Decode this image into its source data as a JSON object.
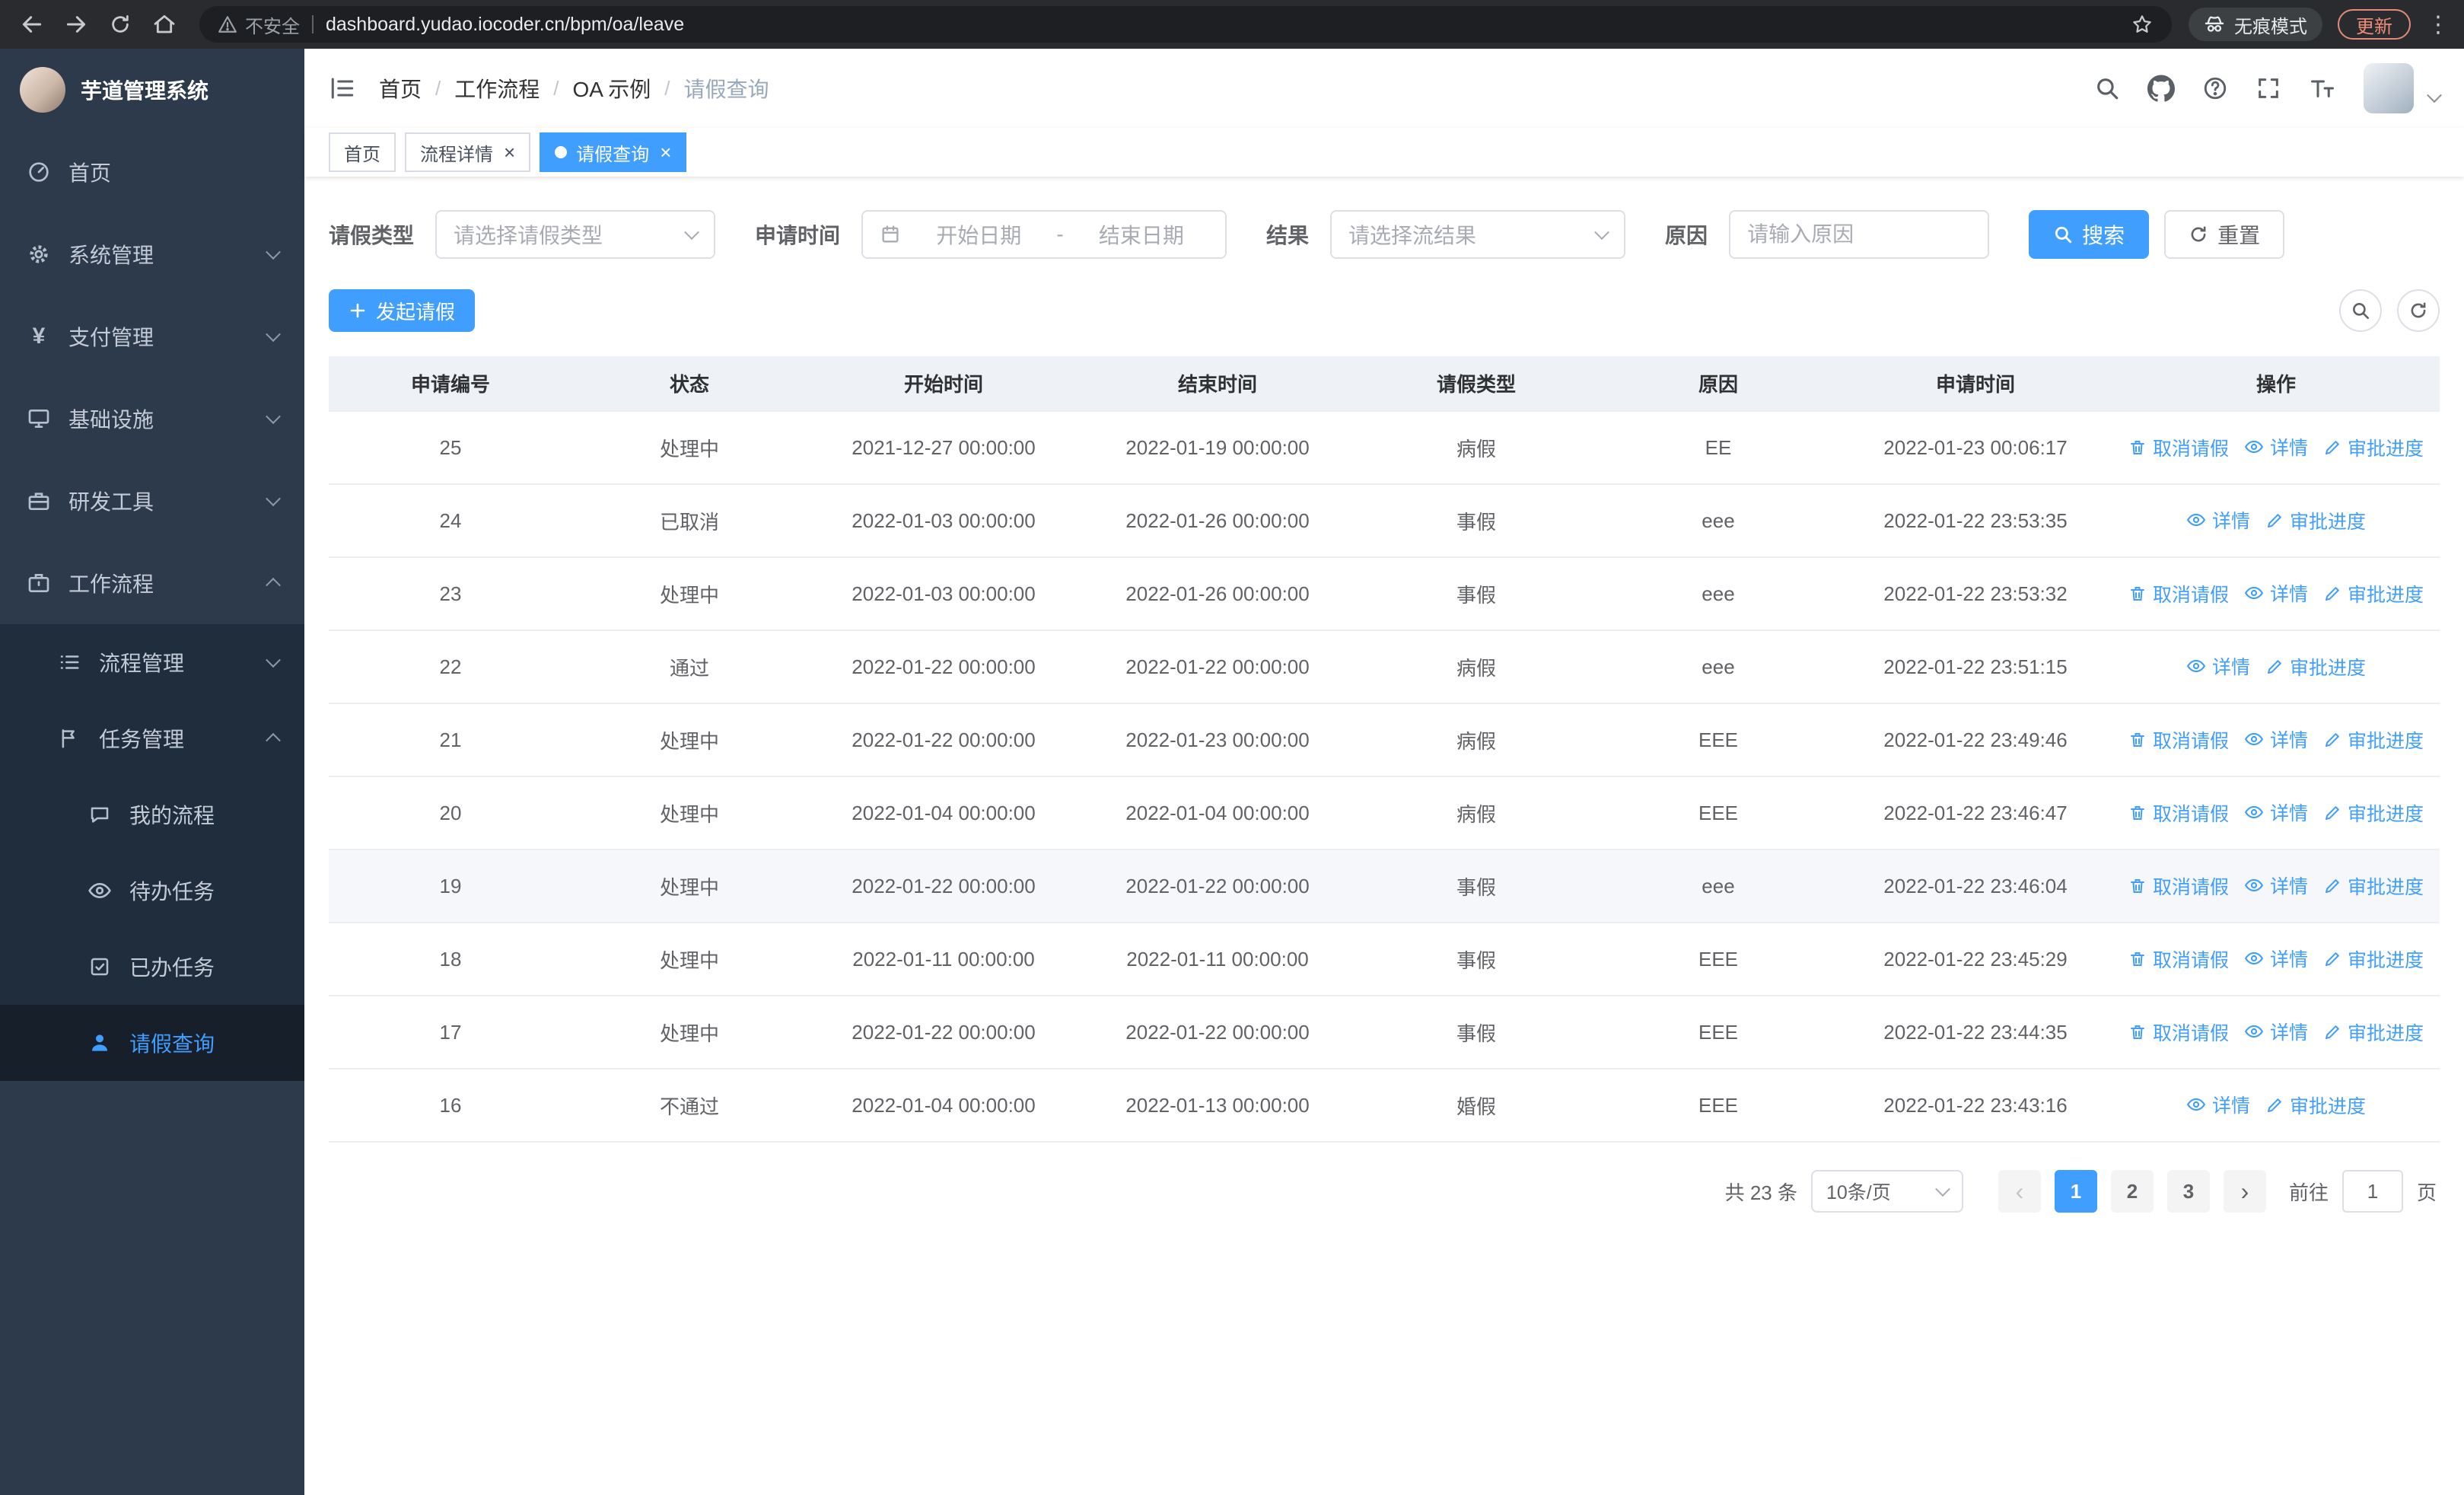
{
  "browser": {
    "security_label": "不安全",
    "url": "dashboard.yudao.iocoder.cn/bpm/oa/leave",
    "incognito_label": "无痕模式",
    "update_label": "更新"
  },
  "sidebar": {
    "logo_title": "芋道管理系统",
    "items": [
      {
        "label": "首页",
        "icon": "dashboard-icon"
      },
      {
        "label": "系统管理",
        "icon": "gear-icon"
      },
      {
        "label": "支付管理",
        "icon": "yen-icon"
      },
      {
        "label": "基础设施",
        "icon": "monitor-icon"
      },
      {
        "label": "研发工具",
        "icon": "toolbox-icon"
      },
      {
        "label": "工作流程",
        "icon": "briefcase-icon"
      }
    ],
    "workflow_children": [
      {
        "label": "流程管理",
        "icon": "list-icon"
      },
      {
        "label": "任务管理",
        "icon": "flag-icon"
      }
    ],
    "task_children": [
      {
        "label": "我的流程",
        "icon": "chat-icon"
      },
      {
        "label": "待办任务",
        "icon": "eye-icon"
      },
      {
        "label": "已办任务",
        "icon": "check-square-icon"
      },
      {
        "label": "请假查询",
        "icon": "user-icon",
        "active": true
      }
    ]
  },
  "header": {
    "breadcrumbs": [
      "首页",
      "工作流程",
      "OA 示例",
      "请假查询"
    ],
    "separator": "/"
  },
  "tabs": [
    {
      "label": "首页",
      "active": false,
      "closable": false
    },
    {
      "label": "流程详情",
      "active": false,
      "closable": true
    },
    {
      "label": "请假查询",
      "active": true,
      "closable": true
    }
  ],
  "filters": {
    "leave_type_label": "请假类型",
    "leave_type_placeholder": "请选择请假类型",
    "apply_time_label": "申请时间",
    "start_date_placeholder": "开始日期",
    "range_separator": "-",
    "end_date_placeholder": "结束日期",
    "result_label": "结果",
    "result_placeholder": "请选择流结果",
    "reason_label": "原因",
    "reason_placeholder": "请输入原因",
    "search_label": "搜索",
    "reset_label": "重置"
  },
  "toolbar": {
    "create_label": "发起请假"
  },
  "table": {
    "columns": [
      "申请编号",
      "状态",
      "开始时间",
      "结束时间",
      "请假类型",
      "原因",
      "申请时间",
      "操作"
    ],
    "actions": {
      "cancel": {
        "label": "取消请假",
        "name": "cancel-leave",
        "icon": "trash-icon"
      },
      "detail": {
        "label": "详情",
        "name": "detail",
        "icon": "eye-icon"
      },
      "progress": {
        "label": "审批进度",
        "name": "approval-progress",
        "icon": "edit-icon"
      }
    },
    "rows": [
      {
        "id": "25",
        "status": "处理中",
        "start_time": "2021-12-27 00:00:00",
        "end_time": "2022-01-19 00:00:00",
        "leave_type": "病假",
        "reason": "EE",
        "apply_time": "2022-01-23 00:06:17",
        "can_cancel": true
      },
      {
        "id": "24",
        "status": "已取消",
        "start_time": "2022-01-03 00:00:00",
        "end_time": "2022-01-26 00:00:00",
        "leave_type": "事假",
        "reason": "eee",
        "apply_time": "2022-01-22 23:53:35",
        "can_cancel": false
      },
      {
        "id": "23",
        "status": "处理中",
        "start_time": "2022-01-03 00:00:00",
        "end_time": "2022-01-26 00:00:00",
        "leave_type": "事假",
        "reason": "eee",
        "apply_time": "2022-01-22 23:53:32",
        "can_cancel": true
      },
      {
        "id": "22",
        "status": "通过",
        "start_time": "2022-01-22 00:00:00",
        "end_time": "2022-01-22 00:00:00",
        "leave_type": "病假",
        "reason": "eee",
        "apply_time": "2022-01-22 23:51:15",
        "can_cancel": false
      },
      {
        "id": "21",
        "status": "处理中",
        "start_time": "2022-01-22 00:00:00",
        "end_time": "2022-01-23 00:00:00",
        "leave_type": "病假",
        "reason": "EEE",
        "apply_time": "2022-01-22 23:49:46",
        "can_cancel": true
      },
      {
        "id": "20",
        "status": "处理中",
        "start_time": "2022-01-04 00:00:00",
        "end_time": "2022-01-04 00:00:00",
        "leave_type": "病假",
        "reason": "EEE",
        "apply_time": "2022-01-22 23:46:47",
        "can_cancel": true
      },
      {
        "id": "19",
        "status": "处理中",
        "start_time": "2022-01-22 00:00:00",
        "end_time": "2022-01-22 00:00:00",
        "leave_type": "事假",
        "reason": "eee",
        "apply_time": "2022-01-22 23:46:04",
        "can_cancel": true,
        "hovered": true
      },
      {
        "id": "18",
        "status": "处理中",
        "start_time": "2022-01-11 00:00:00",
        "end_time": "2022-01-11 00:00:00",
        "leave_type": "事假",
        "reason": "EEE",
        "apply_time": "2022-01-22 23:45:29",
        "can_cancel": true
      },
      {
        "id": "17",
        "status": "处理中",
        "start_time": "2022-01-22 00:00:00",
        "end_time": "2022-01-22 00:00:00",
        "leave_type": "事假",
        "reason": "EEE",
        "apply_time": "2022-01-22 23:44:35",
        "can_cancel": true
      },
      {
        "id": "16",
        "status": "不通过",
        "start_time": "2022-01-04 00:00:00",
        "end_time": "2022-01-13 00:00:00",
        "leave_type": "婚假",
        "reason": "EEE",
        "apply_time": "2022-01-22 23:43:16",
        "can_cancel": false
      }
    ]
  },
  "pagination": {
    "total_text": "共 23 条",
    "page_size": "10条/页",
    "pages": [
      "1",
      "2",
      "3"
    ],
    "active_page": "1",
    "goto_label": "前往",
    "goto_value": "1",
    "page_unit": "页"
  },
  "colors": {
    "primary": "#409eff",
    "sidebar_bg": "#2d3a4b",
    "submenu_bg": "#1f2d3d"
  }
}
